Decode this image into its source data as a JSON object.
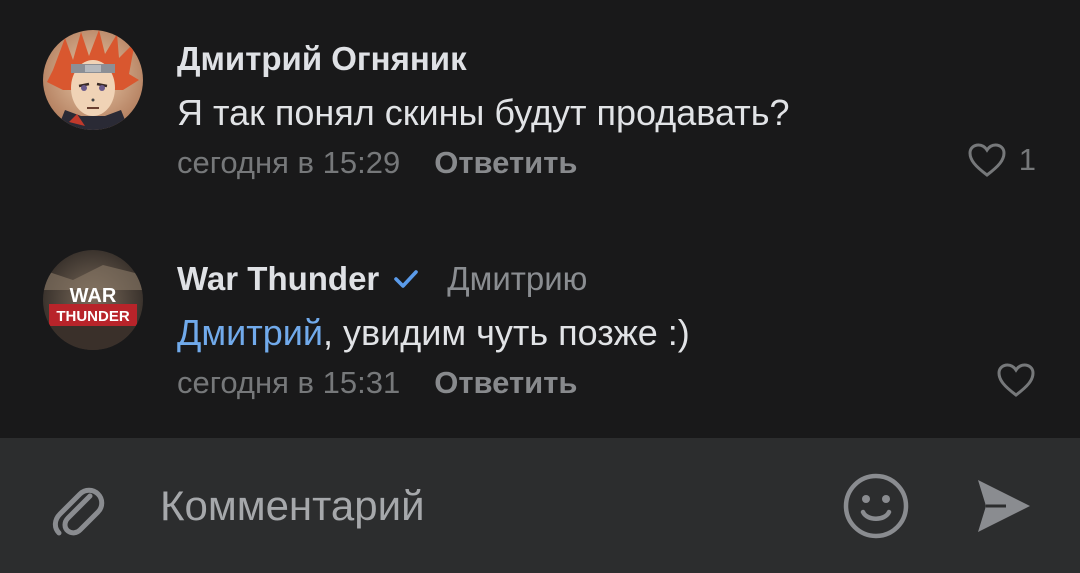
{
  "comments": [
    {
      "author": "Дмитрий Огняник",
      "text": "Я так понял скины будут продавать?",
      "time": "сегодня в 15:29",
      "reply_label": "Ответить",
      "likes": "1",
      "avatar_icon": "anime-character-avatar"
    },
    {
      "author": "War Thunder",
      "verified": true,
      "reply_to": "Дмитрию",
      "mention": "Дмитрий",
      "text": ", увидим чуть позже :)",
      "time": "сегодня в 15:31",
      "reply_label": "Ответить",
      "avatar_lines": [
        "WAR",
        "THUNDER"
      ]
    }
  ],
  "input": {
    "placeholder": "Комментарий"
  },
  "colors": {
    "background": "#19191a",
    "input_bar": "#2c2d2e",
    "mention": "#71aaeb",
    "verified": "#5a9bea",
    "secondary_text": "#76787a"
  },
  "icons": {
    "attach": "paperclip-icon",
    "emoji": "smile-icon",
    "send": "send-icon",
    "like": "heart-icon"
  }
}
